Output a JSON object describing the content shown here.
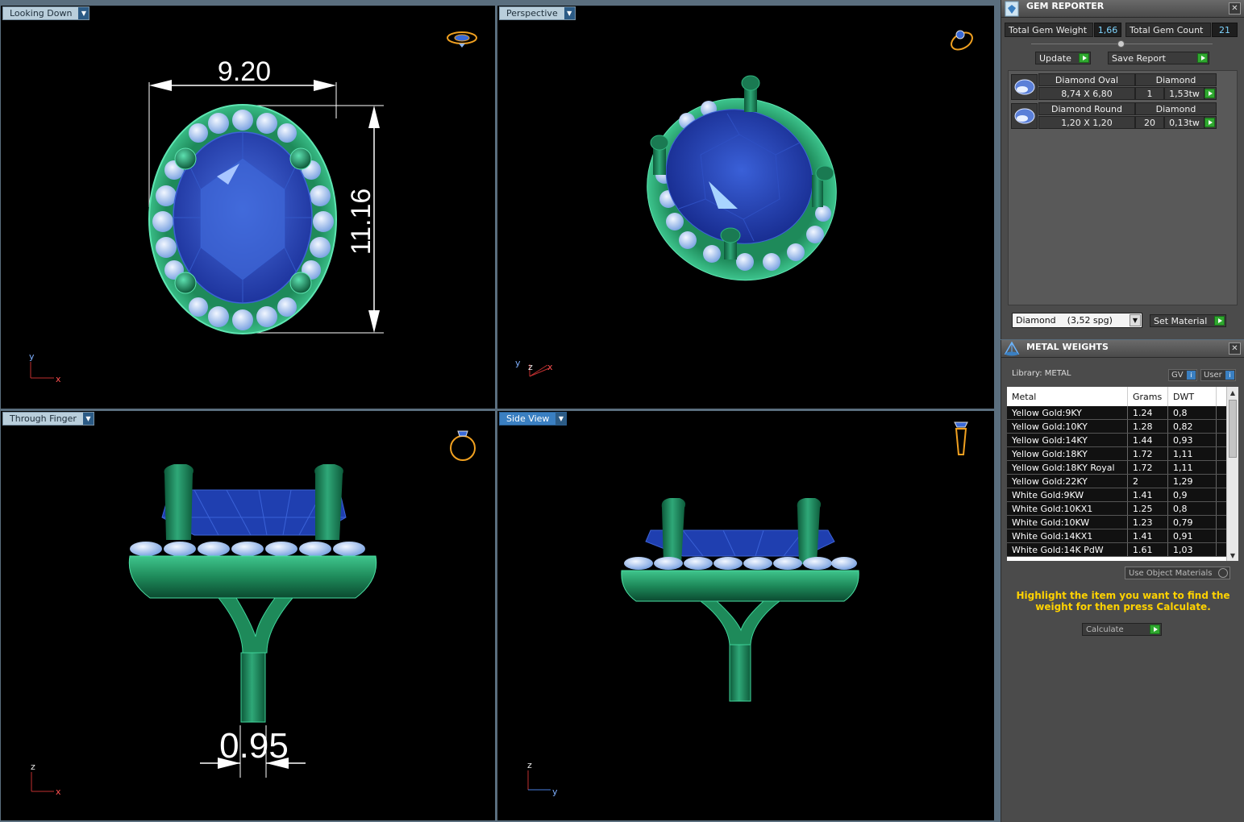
{
  "viewports": {
    "top_left": {
      "label": "Looking Down",
      "dim_width": "9.20",
      "dim_height": "11.16",
      "axis_v": "y",
      "axis_h": "x"
    },
    "top_right": {
      "label": "Perspective",
      "axis_a": "y",
      "axis_b": "z",
      "axis_c": "x"
    },
    "bottom_left": {
      "label": "Through Finger",
      "dim_shank": "0.95",
      "axis_v": "z",
      "axis_h": "x"
    },
    "bottom_right": {
      "label": "Side View",
      "axis_v": "z",
      "axis_h": "y"
    }
  },
  "gem_reporter": {
    "title": "GEM REPORTER",
    "close": "✕",
    "total_weight_label": "Total Gem Weight",
    "total_weight_value": "1,66",
    "total_count_label": "Total Gem Count",
    "total_count_value": "21",
    "update_label": "Update",
    "save_report_label": "Save Report",
    "gems": [
      {
        "shape": "Diamond Oval",
        "material": "Diamond",
        "size": "8,74 X 6,80",
        "count": "1",
        "weight": "1,53tw"
      },
      {
        "shape": "Diamond Round",
        "material": "Diamond",
        "size": "1,20 X 1,20",
        "count": "20",
        "weight": "0,13tw"
      }
    ],
    "material_select": "Diamond    (3,52 spg)",
    "set_material_label": "Set Material"
  },
  "metal_weights": {
    "title": "METAL WEIGHTS",
    "close": "✕",
    "library_label": "Library: METAL",
    "gv_label": "GV",
    "user_label": "User",
    "info_glyph": "i",
    "columns": [
      "Metal",
      "Grams",
      "DWT"
    ],
    "rows": [
      [
        "Yellow Gold:9KY",
        "1.24",
        "0,8"
      ],
      [
        "Yellow Gold:10KY",
        "1.28",
        "0,82"
      ],
      [
        "Yellow Gold:14KY",
        "1.44",
        "0,93"
      ],
      [
        "Yellow Gold:18KY",
        "1.72",
        "1,11"
      ],
      [
        "Yellow Gold:18KY Royal",
        "1.72",
        "1,11"
      ],
      [
        "Yellow Gold:22KY",
        "2",
        "1,29"
      ],
      [
        "White Gold:9KW",
        "1.41",
        "0,9"
      ],
      [
        "White Gold:10KX1",
        "1.25",
        "0,8"
      ],
      [
        "White Gold:10KW",
        "1.23",
        "0,79"
      ],
      [
        "White Gold:14KX1",
        "1.41",
        "0,91"
      ],
      [
        "White Gold:14K PdW",
        "1.61",
        "1,03"
      ]
    ],
    "use_object_materials": "Use Object Materials",
    "hint": "Highlight the item you want to find the weight for then press Calculate.",
    "calculate_label": "Calculate"
  },
  "colors": {
    "metal": "#1e8a5a",
    "metal_light": "#3fd49a",
    "gem_blue": "#1f3fb0",
    "melee": "#8fb4ea",
    "accent": "#3a7fc1",
    "go": "#2fa82f",
    "hint": "#ffd200"
  },
  "icons": {
    "panel_gem": "gem-reporter-icon",
    "panel_metal": "metal-weights-icon",
    "orient": "ring-orientation-icon",
    "dropdown": "chevron-down-icon",
    "go": "play-arrow-icon"
  }
}
